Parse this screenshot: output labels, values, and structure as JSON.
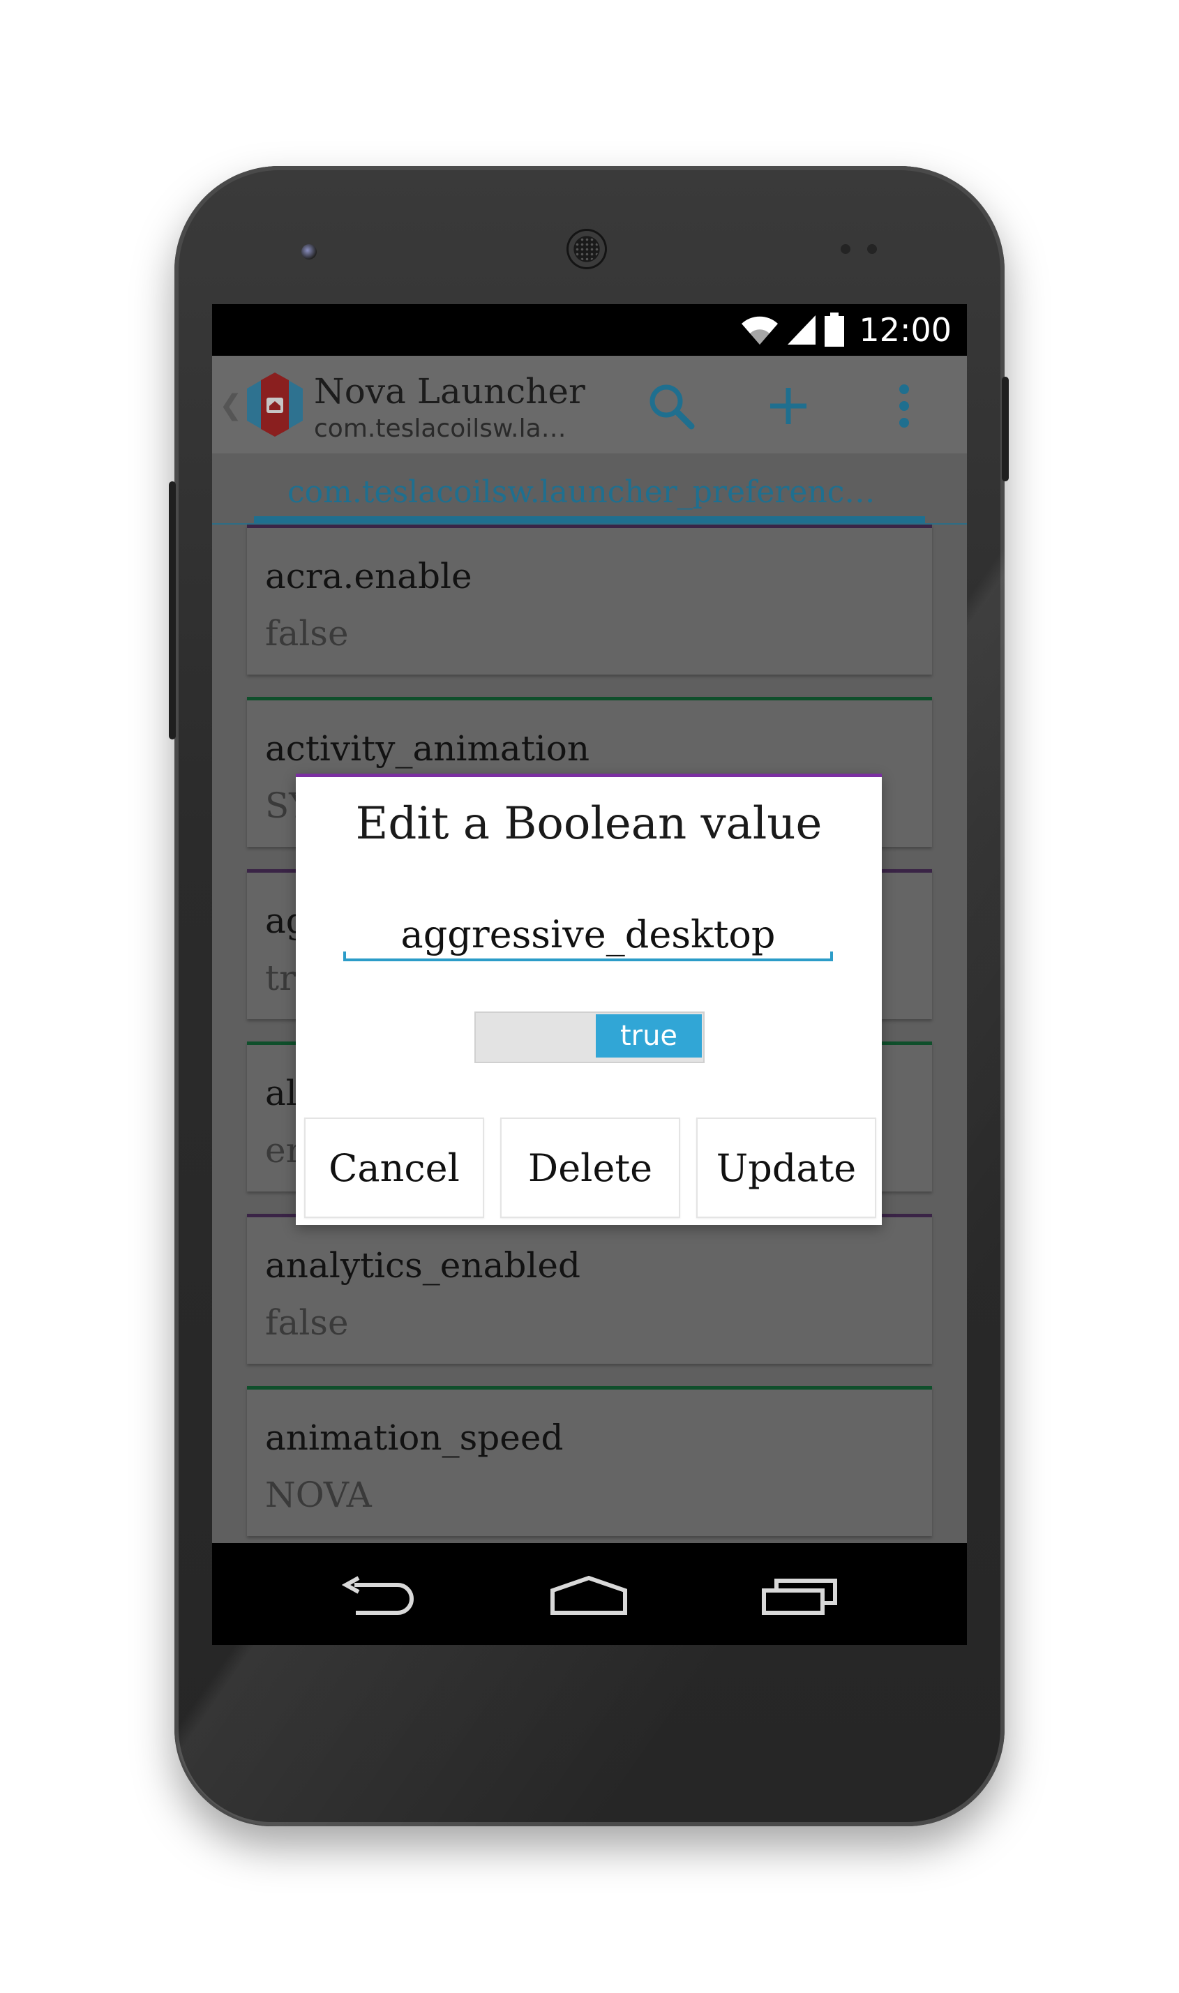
{
  "status_bar": {
    "time": "12:00"
  },
  "action_bar": {
    "title": "Nova Launcher",
    "subtitle": "com.teslacoilsw.la…",
    "icons": [
      "back-chevron-icon",
      "nova-launcher-app-icon",
      "search-icon",
      "add-icon",
      "overflow-menu-icon"
    ]
  },
  "tab": {
    "label": "com.teslacoilsw.launcher_preferenc…"
  },
  "preferences": [
    {
      "key": "acra.enable",
      "value": "false",
      "accent": "#3a2446"
    },
    {
      "key": "activity_animation",
      "value": "SY",
      "accent": "#0f4f2b"
    },
    {
      "key": "ag",
      "value": "tr",
      "accent": "#3a2446"
    },
    {
      "key": "al",
      "value": "er",
      "accent": "#0f4f2b"
    },
    {
      "key": "analytics_enabled",
      "value": "false",
      "accent": "#3a2446"
    },
    {
      "key": "animation_speed",
      "value": "NOVA",
      "accent": "#0f4f2b"
    }
  ],
  "dialog": {
    "title": "Edit a Boolean value",
    "key_value": "aggressive_desktop",
    "toggle_label": "true",
    "buttons": {
      "cancel": "Cancel",
      "delete": "Delete",
      "update": "Update"
    },
    "accent": "#7b2fa1"
  },
  "nav_bar": {
    "icons": [
      "back-icon",
      "home-icon",
      "recent-apps-icon"
    ]
  },
  "colors": {
    "primary": "#31a6d6",
    "tab_text": "#1f6f8f"
  }
}
